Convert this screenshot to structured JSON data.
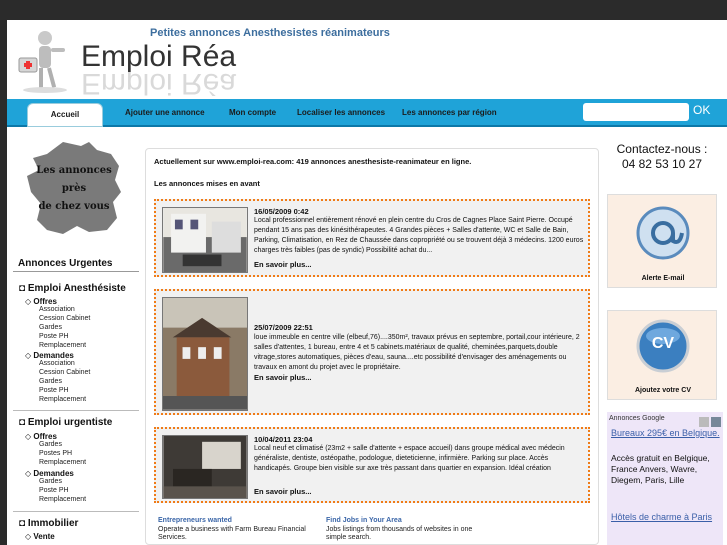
{
  "header": {
    "tagline": "Petites annonces Anesthesistes réanimateurs",
    "logo": "Emploi Réa"
  },
  "nav": {
    "tabs": [
      "Accueil",
      "Ajouter une annonce",
      "Mon compte",
      "Localiser les annonces",
      "Les annonces par région"
    ],
    "search_placeholder": "",
    "ok_label": "OK"
  },
  "left": {
    "map_lines": [
      "Les annonces",
      "près",
      "de chez vous"
    ],
    "urgent_title": "Annonces Urgentes",
    "cat1": "Emploi Anesthésiste",
    "offres": "Offres",
    "demandes": "Demandes",
    "cat1_offres_items": [
      "Association",
      "Cession Cabinet",
      "Gardes",
      "Poste PH",
      "Remplacement"
    ],
    "cat1_demandes_items": [
      "Association",
      "Cession Cabinet",
      "Gardes",
      "Poste PH",
      "Remplacement"
    ],
    "cat2": "Emploi urgentiste",
    "cat2_offres_items": [
      "Gardes",
      "Postes PH",
      "Remplacement"
    ],
    "cat2_demandes_items": [
      "Gardes",
      "Poste PH",
      "Remplacement"
    ],
    "cat3": "Immobilier",
    "vente": "Vente"
  },
  "main": {
    "intro": "Actuellement sur www.emploi-rea.com: 419 annonces anesthesiste-reanimateur en ligne.",
    "mises_title": "Les annonces mises en avant",
    "more_label": "En savoir plus...",
    "announcements": [
      {
        "date": "16/05/2009 0:42",
        "text": "Local professionnel entièrement rénové en plein centre du Cros de Cagnes Place Saint Pierre. Occupé pendant 15 ans pas des kinésithérapeutes. 4 Grandes pièces + Salles d'attente, WC et Salle de Bain, Parking, Climatisation, en Rez de Chaussée dans copropriété ou se trouvent déjà 3 médecins. 1200 euros charges très faibles (pas de syndic) Possibilité achat du..."
      },
      {
        "date": "25/07/2009 22:51",
        "text": "loue immeuble en centre ville (elbeuf,76)....350m², travaux prévus en septembre, portail,cour intérieure, 2 salles d'attentes, 1 bureau, entre 4 et 5 cabinets.matériaux de qualité, cheminées,parquets,double vitrage,stores automatiques, pièces d'eau, sauna....etc possibilité d'envisager des aménagements ou travaux en amont du projet avec le propriétaire."
      },
      {
        "date": "10/04/2011 23:04",
        "text": "Local neuf et climatisé (23m2 + salle d'attente + espace accueil) dans groupe médical avec médecin généraliste, dentiste, ostéopathe, podologue, dieteticienne, infirmière. Parking sur place. Accès handicapés. Groupe bien visible sur axe très passant dans quartier en expansion. Idéal création"
      }
    ],
    "ads": [
      {
        "title": "Entrepreneurs wanted",
        "text": "Operate a business with Farm Bureau Financial Services."
      },
      {
        "title": "Find Jobs in Your Area",
        "text": "Jobs listings from thousands of websites in one simple search."
      }
    ]
  },
  "right": {
    "contact_line1": "Contactez-nous :",
    "contact_phone": "04 82 53 10 27",
    "alerte_label": "Alerte E-mail",
    "cv_label": "Ajoutez votre CV",
    "cv_icon_text": "CV",
    "ads_head": "Annonces Google",
    "ad1_link": "Bureaux 295€ en Belgique.",
    "ad1_text": "Accès gratuit en Belgique, France Anvers, Wavre, Diegem, Paris, Lille",
    "ad2_link": "Hôtels de charme à Paris"
  },
  "colors": {
    "nav_bg": "#1fa3d8",
    "accent_orange": "#f07b16",
    "tagline": "#3d6e9e"
  }
}
